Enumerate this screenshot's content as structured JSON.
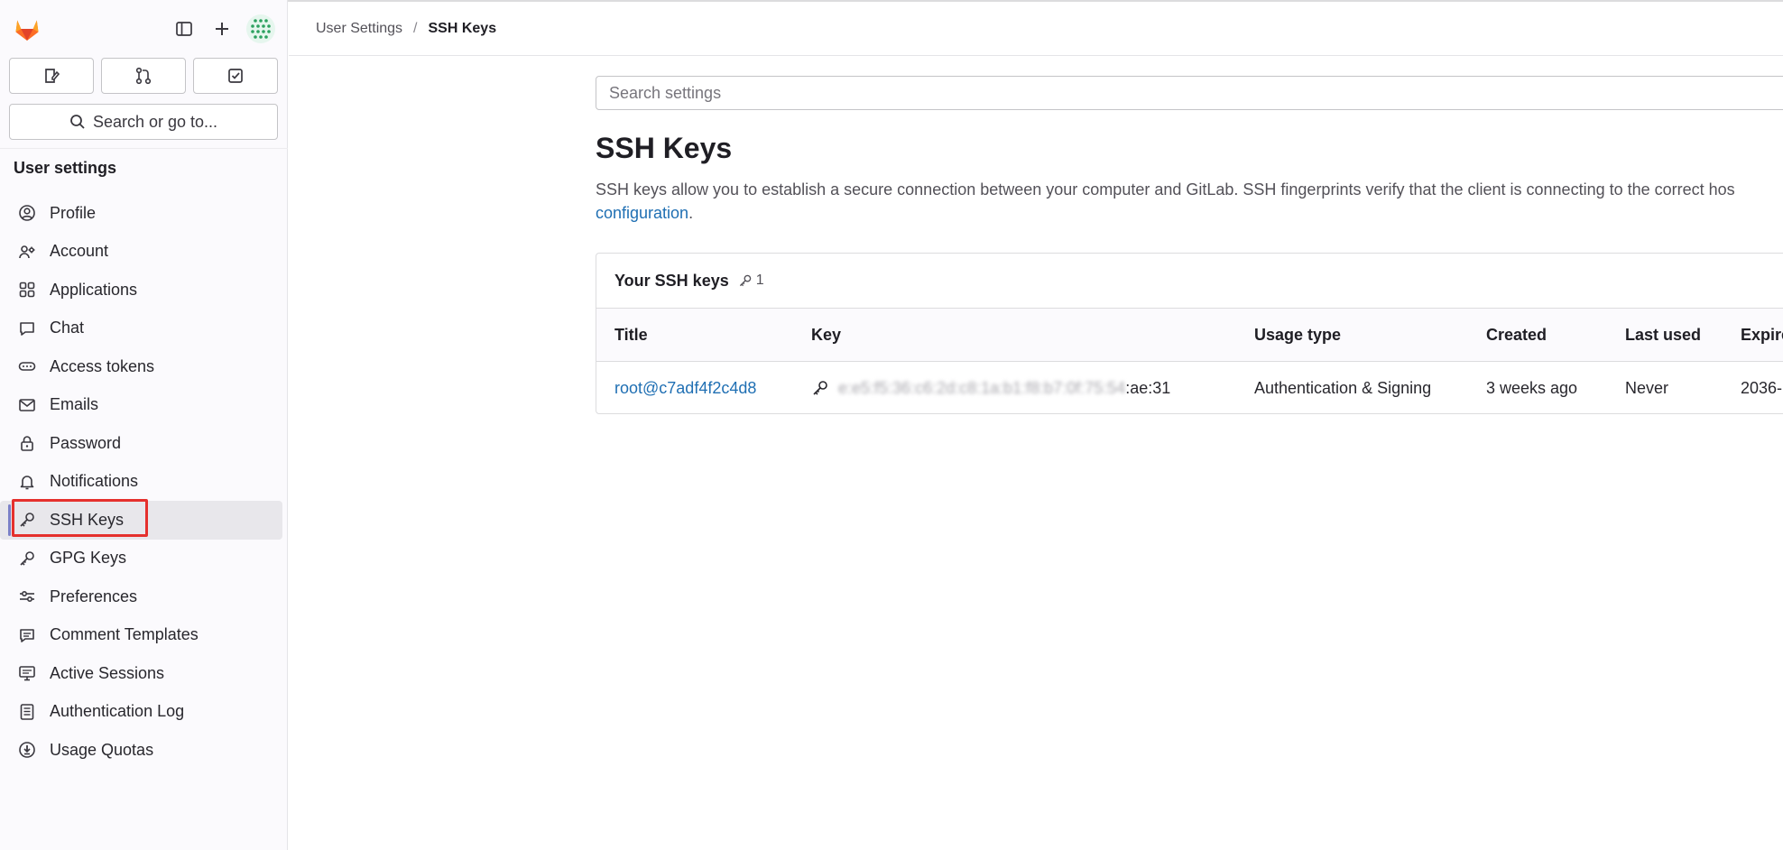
{
  "breadcrumb": {
    "parent": "User Settings",
    "separator": "/",
    "current": "SSH Keys"
  },
  "sidebar": {
    "search_label": "Search or go to...",
    "heading": "User settings",
    "items": [
      {
        "label": "Profile",
        "icon": "profile-icon"
      },
      {
        "label": "Account",
        "icon": "account-icon"
      },
      {
        "label": "Applications",
        "icon": "applications-icon"
      },
      {
        "label": "Chat",
        "icon": "chat-icon"
      },
      {
        "label": "Access tokens",
        "icon": "token-icon"
      },
      {
        "label": "Emails",
        "icon": "mail-icon"
      },
      {
        "label": "Password",
        "icon": "lock-icon"
      },
      {
        "label": "Notifications",
        "icon": "bell-icon"
      },
      {
        "label": "SSH Keys",
        "icon": "key-icon",
        "active": true
      },
      {
        "label": "GPG Keys",
        "icon": "key-icon"
      },
      {
        "label": "Preferences",
        "icon": "preferences-icon"
      },
      {
        "label": "Comment Templates",
        "icon": "comment-icon"
      },
      {
        "label": "Active Sessions",
        "icon": "monitor-icon"
      },
      {
        "label": "Authentication Log",
        "icon": "log-icon"
      },
      {
        "label": "Usage Quotas",
        "icon": "quota-icon"
      }
    ]
  },
  "main": {
    "search_placeholder": "Search settings",
    "title": "SSH Keys",
    "description": "SSH keys allow you to establish a secure connection between your computer and GitLab. SSH fingerprints verify that the client is connecting to the correct hos",
    "description_link": "configuration",
    "description_end": ".",
    "card": {
      "title": "Your SSH keys",
      "count": "1",
      "columns": [
        "Title",
        "Key",
        "Usage type",
        "Created",
        "Last used",
        "Expire"
      ],
      "rows": [
        {
          "title": "root@c7adf4f2c4d8",
          "key_obscured": "e:e5:f5:36:c6:2d:c8:1a:b1:f8:b7:0f:75:54",
          "key_tail": ":ae:31",
          "usage": "Authentication & Signing",
          "created": "3 weeks ago",
          "last_used": "Never",
          "expires": "2036-"
        }
      ]
    }
  },
  "colors": {
    "link": "#1f6fb3",
    "highlight_border": "#e5302d",
    "active_indicator": "#7b81c8",
    "gitlab_orange": "#e24329"
  }
}
